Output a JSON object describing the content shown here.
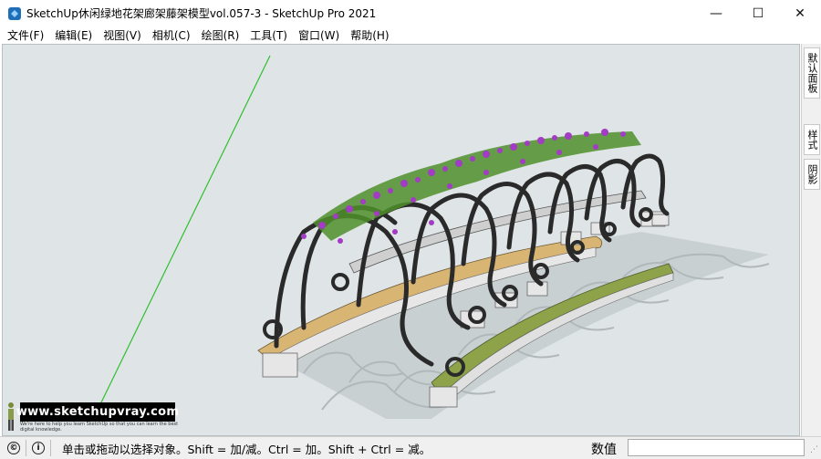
{
  "window": {
    "title": "SketchUp休闲绿地花架廊架藤架模型vol.057-3 - SketchUp Pro 2021",
    "minimize": "—",
    "maximize": "☐",
    "close": "✕"
  },
  "menu": [
    "文件(F)",
    "编辑(E)",
    "视图(V)",
    "相机(C)",
    "绘图(R)",
    "工具(T)",
    "窗口(W)",
    "帮助(H)"
  ],
  "tray": {
    "tabs": [
      "默认面板",
      "样式",
      "阴影"
    ]
  },
  "watermark": {
    "site": "www.sketchupvray.com",
    "subtext": "We're here to help you learn SketchUp so that you can learn the best digital knowledge."
  },
  "status": {
    "hint": "单击或拖动以选择对象。Shift = 加/减。Ctrl = 加。Shift + Ctrl = 减。",
    "measurement_label": "数值",
    "measurement_value": ""
  },
  "colors": {
    "viewport_bg": "#dfe5e7",
    "green_axis": "#2fbf2f",
    "wood": "#d9b574",
    "metal": "#2a2a2a",
    "flowers": "#a23cc4",
    "leaves": "#4f8f2a",
    "grass": "#8ea24a"
  }
}
